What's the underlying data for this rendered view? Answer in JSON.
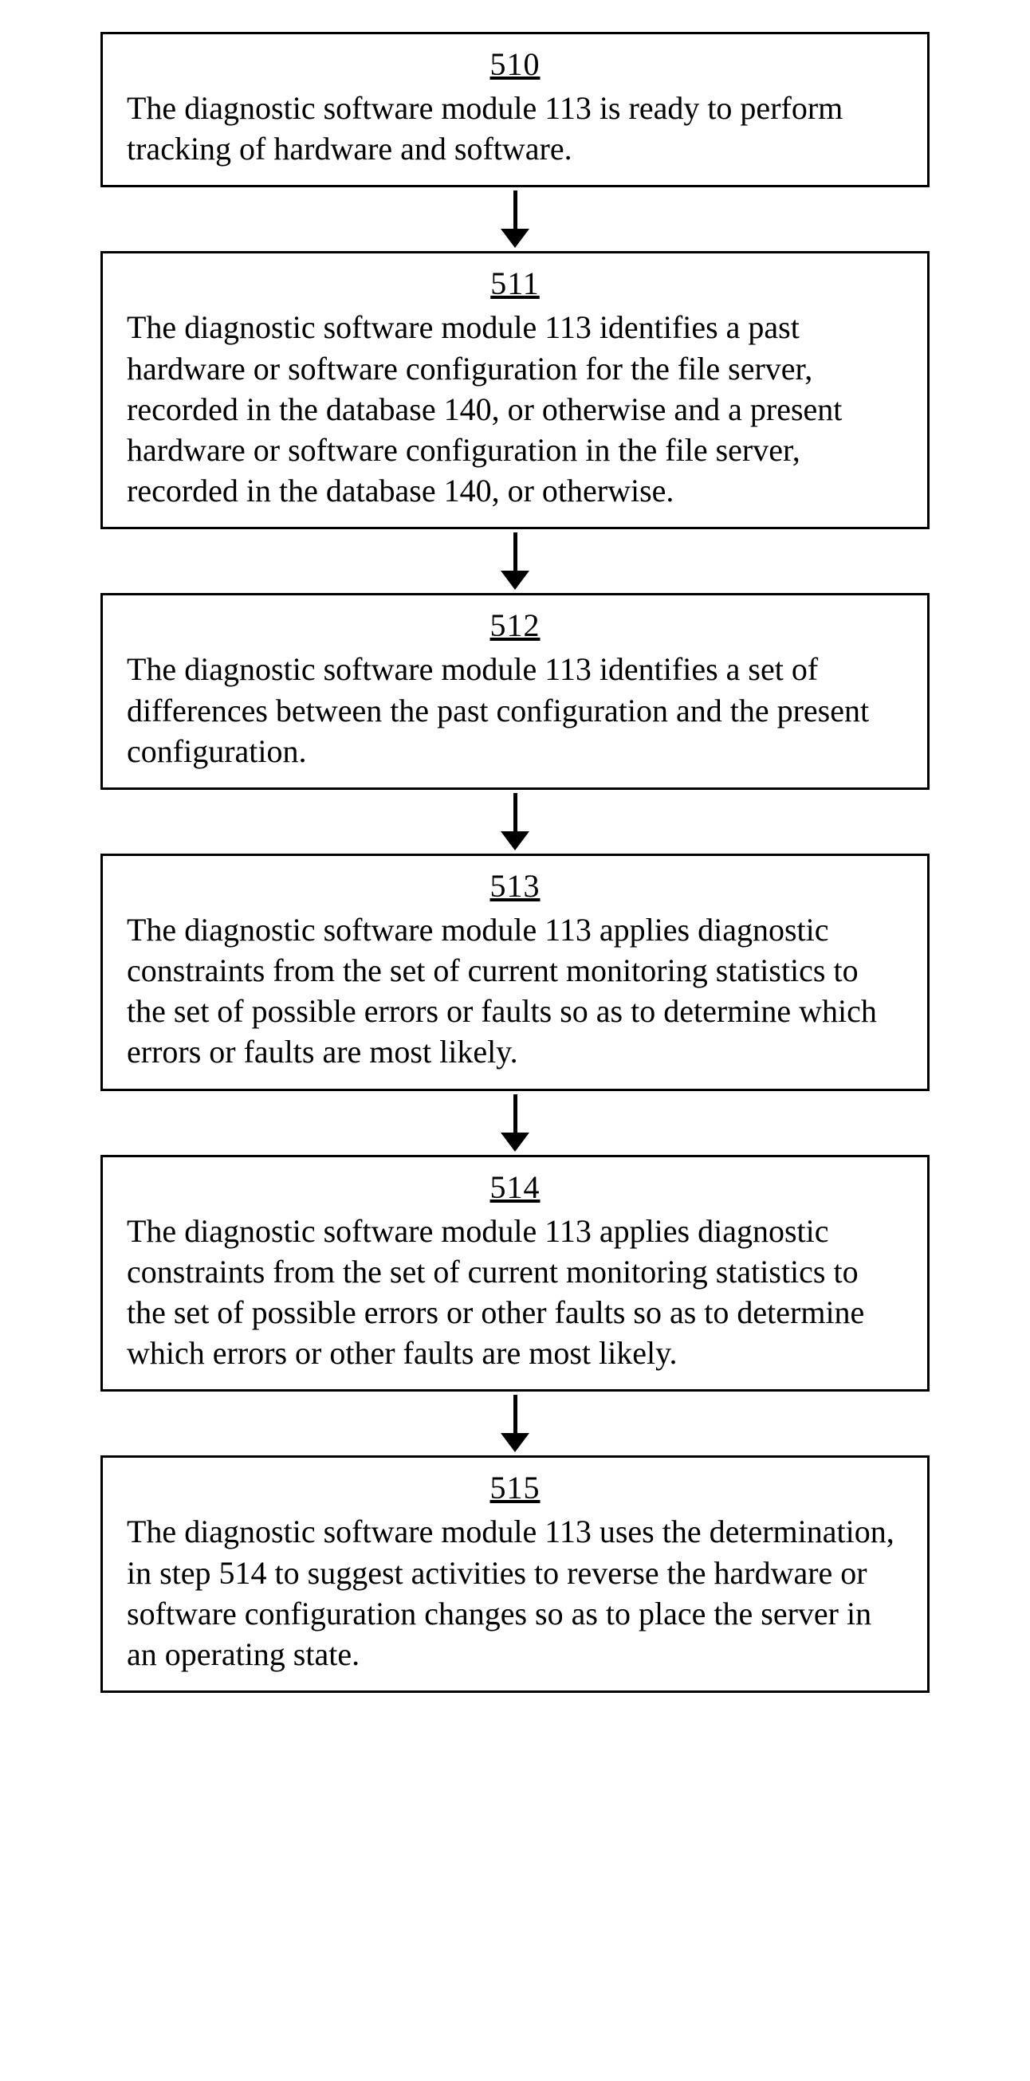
{
  "steps": [
    {
      "num": "510",
      "text": "The diagnostic software module 113 is ready to perform tracking of hardware and software."
    },
    {
      "num": "511",
      "text": "The diagnostic software module 113 identifies a past hardware or software configuration for the file server, recorded in the database 140, or otherwise and a present hardware or software configuration in the file server, recorded in the database 140, or otherwise."
    },
    {
      "num": "512",
      "text": "The diagnostic software module 113 identifies a set of differences between the past configuration and the present configuration."
    },
    {
      "num": "513",
      "text": "The diagnostic software module 113 applies diagnostic constraints from the set of current monitoring statistics to the set of possible errors or faults so as to determine which errors or faults are most likely."
    },
    {
      "num": "514",
      "text": "The diagnostic software module 113 applies diagnostic constraints from the set of current monitoring statistics to the set of possible errors or other faults so as to determine which errors or other faults are most likely."
    },
    {
      "num": "515",
      "text": "The diagnostic software module 113 uses the determination, in step 514 to suggest activities to reverse the hardware or software configuration changes so as to place the server in an operating state."
    }
  ]
}
